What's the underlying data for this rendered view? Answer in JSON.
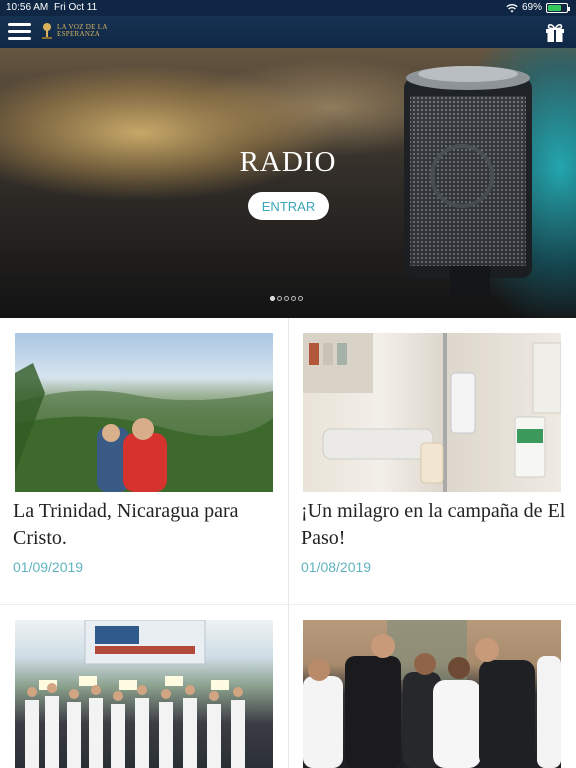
{
  "status_bar": {
    "time": "10:56 AM",
    "date": "Fri Oct 11",
    "battery": "69%"
  },
  "header": {
    "logo_line1": "LA VOZ DE LA",
    "logo_line2": "ESPERANZA",
    "icons": [
      "hamburger-menu-icon",
      "gift-icon"
    ]
  },
  "hero": {
    "title": "RADIO",
    "button_label": "ENTRAR",
    "slides_total": 5,
    "active_slide": 1
  },
  "articles": [
    {
      "title": "La Trinidad, Nicaragua para Cristo.",
      "date": "01/09/2019"
    },
    {
      "title": "¡Un milagro en la campaña de El Paso!",
      "date": "01/08/2019"
    },
    {
      "title": "",
      "date": ""
    },
    {
      "title": "",
      "date": ""
    }
  ],
  "colors": {
    "header_bg": "#102845",
    "accent": "#5fb3c0",
    "logo_gold": "#d9b35c"
  }
}
